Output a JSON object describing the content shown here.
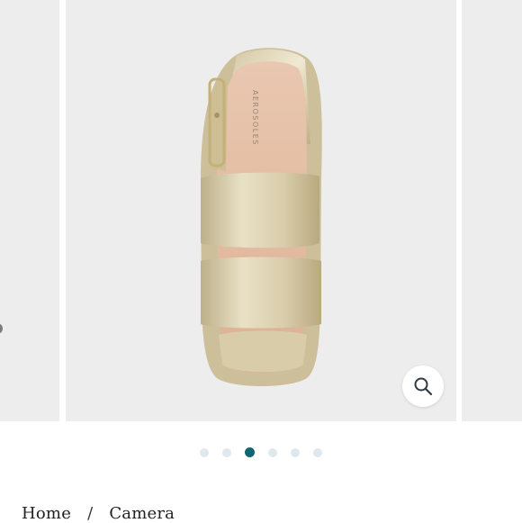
{
  "product": {
    "brand_mark": "AEROSOLES",
    "carousel": {
      "slide_count": 6,
      "active_index": 2
    },
    "zoom_icon": "magnifier-icon"
  },
  "breadcrumb": {
    "items": [
      "Home",
      "Camera"
    ],
    "separator": "/"
  },
  "colors": {
    "accent": "#0f6670",
    "dot_inactive": "#dfe8ec",
    "slide_background": "#ededee"
  }
}
